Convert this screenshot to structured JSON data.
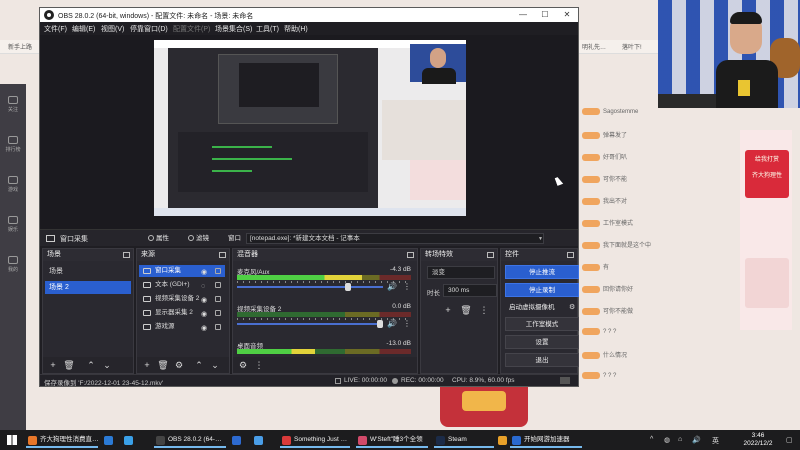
{
  "background": {
    "tabs": [
      "新手上路",
      "明礼先…",
      "落叶下!"
    ],
    "sidebar": [
      "关注",
      "排行榜",
      "游戏",
      "娱乐",
      "我的"
    ],
    "chat": [
      "Sagostemme",
      "弹幕发了",
      "好哥们叭",
      "可你不能",
      "我出不对",
      "工作室模式",
      "我下面就是这个中",
      "有",
      "回你请你好",
      "可你不能做",
      "? ? ?",
      "什么情况",
      "? ? ?"
    ],
    "gift_text": "给我打赏",
    "gift_sub": "齐大狗理性"
  },
  "obs": {
    "title": "OBS 28.0.2 (64-bit, windows) - 配置文件: 未命名 - 场景: 未命名",
    "window_buttons": [
      "—",
      "☐",
      "✕"
    ],
    "menu": [
      {
        "label": "文件(F)",
        "dim": false
      },
      {
        "label": "编辑(E)",
        "dim": false
      },
      {
        "label": "视图(V)",
        "dim": false
      },
      {
        "label": "停靠窗口(D)",
        "dim": false
      },
      {
        "label": "配置文件(P)",
        "dim": true
      },
      {
        "label": "场景集合(S)",
        "dim": false
      },
      {
        "label": "工具(T)",
        "dim": false
      },
      {
        "label": "帮助(H)",
        "dim": false
      }
    ],
    "source_toolbar": {
      "source_name": "窗口采集",
      "properties": "属性",
      "filters": "滤镜",
      "window_label": "窗口",
      "window_value": "[notepad.exe]: *新建文本文档 - 记事本"
    },
    "scenes": {
      "title": "场景",
      "items": [
        {
          "label": "场景",
          "selected": false
        },
        {
          "label": "场景 2",
          "selected": true
        }
      ]
    },
    "sources": {
      "title": "来源",
      "items": [
        {
          "label": "窗口采集",
          "selected": true,
          "icon": "window-icon"
        },
        {
          "label": "文本 (GDI+)",
          "selected": false,
          "icon": "text-icon"
        },
        {
          "label": "视频采集设备 2",
          "selected": false,
          "icon": "camera-icon"
        },
        {
          "label": "显示器采集 2",
          "selected": false,
          "icon": "monitor-icon"
        },
        {
          "label": "游戏源",
          "selected": false,
          "icon": "gamepad-icon"
        }
      ]
    },
    "mixer": {
      "title": "混音器",
      "channels": [
        {
          "name": "麦克风/Aux",
          "db": "-4.3 dB",
          "level": 0.72,
          "volume": 0.78
        },
        {
          "name": "视频采集设备 2",
          "db": "0.0 dB",
          "level": 0.0,
          "volume": 1.0
        },
        {
          "name": "桌面音频",
          "db": "-13.0 dB",
          "level": 0.45,
          "volume": 0.9
        }
      ]
    },
    "transitions": {
      "title": "转场特效",
      "type": "淡变",
      "duration_label": "时长",
      "duration": "300 ms"
    },
    "controls": {
      "title": "控件",
      "buttons": [
        {
          "label": "停止推流",
          "active": true
        },
        {
          "label": "停止录制",
          "active": true
        },
        {
          "label": "启动虚拟摄像机",
          "active": false
        },
        {
          "label": "工作室模式",
          "active": false
        },
        {
          "label": "设置",
          "active": false
        },
        {
          "label": "退出",
          "active": false
        }
      ]
    },
    "status": {
      "saved": "保存录像到 'F:/2022-12-01 23-45-12.mkv'",
      "live": "LIVE: 00:00:00",
      "rec": "REC: 00:00:00",
      "cpu": "CPU: 8.9%, 60.00 fps"
    }
  },
  "taskbar": {
    "items": [
      {
        "label": "齐大狗理性消费直…",
        "color": "#e8772a"
      },
      {
        "label": "",
        "color": "#2b7bd6"
      },
      {
        "label": "",
        "color": "#3aa0e8"
      },
      {
        "label": "OBS 28.0.2 (64-…",
        "color": "#444444"
      },
      {
        "label": "",
        "color": "#2d6ad0"
      },
      {
        "label": "",
        "color": "#4a9ee8"
      },
      {
        "label": "Something Just …",
        "color": "#d93a3a"
      },
      {
        "label": "W'Steft\"睡3个全领",
        "color": "#d24a6a"
      },
      {
        "label": "Steam",
        "color": "#1b2b48"
      },
      {
        "label": "",
        "color": "#e8a12a"
      },
      {
        "label": "开始网游加速器",
        "color": "#2a6ad0"
      }
    ],
    "tray": "英",
    "time": "3:46",
    "date": "2022/12/2"
  }
}
